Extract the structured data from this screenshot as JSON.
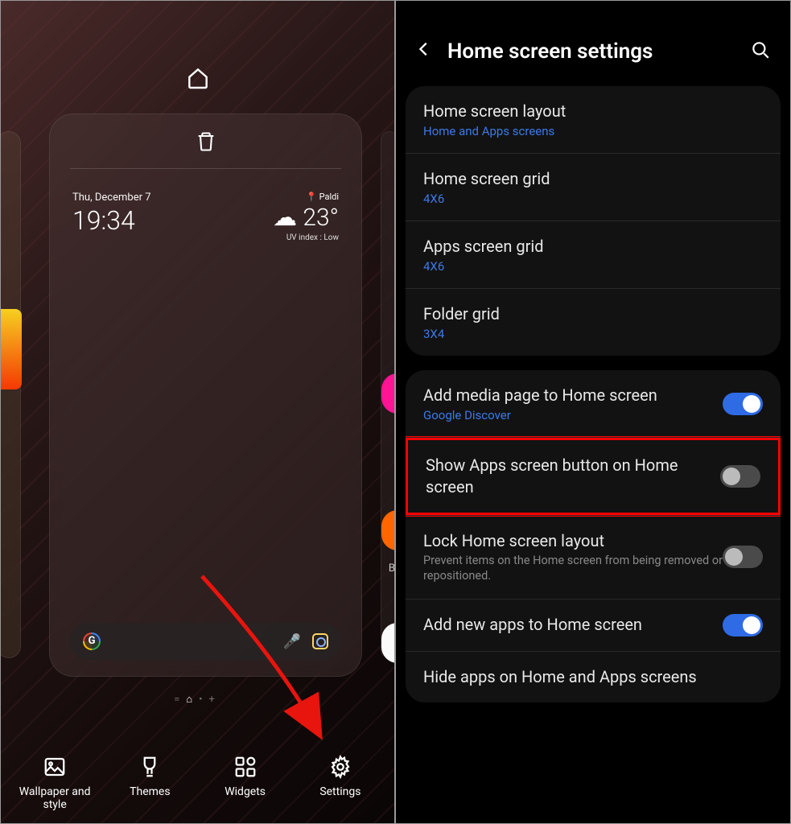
{
  "left": {
    "weather": {
      "date": "Thu, December 7",
      "time": "19:34",
      "location": "Paldi",
      "temperature": "23°",
      "uv": "UV index : Low"
    },
    "peek_letter": "B",
    "page_indicator": {
      "items": [
        "=",
        "⌂",
        "•",
        "+"
      ],
      "active_index": 1
    },
    "toolbar": [
      {
        "label": "Wallpaper and style"
      },
      {
        "label": "Themes"
      },
      {
        "label": "Widgets"
      },
      {
        "label": "Settings"
      }
    ]
  },
  "right": {
    "title": "Home screen settings",
    "section1": [
      {
        "label": "Home screen layout",
        "value": "Home and Apps screens"
      },
      {
        "label": "Home screen grid",
        "value": "4X6"
      },
      {
        "label": "Apps screen grid",
        "value": "4X6"
      },
      {
        "label": "Folder grid",
        "value": "3X4"
      }
    ],
    "section2": [
      {
        "label": "Add media page to Home screen",
        "value": "Google Discover",
        "toggle": true
      },
      {
        "label": "Show Apps screen button on Home screen",
        "toggle": false,
        "highlighted": true
      },
      {
        "label": "Lock Home screen layout",
        "desc": "Prevent items on the Home screen from being removed or repositioned.",
        "toggle": false
      },
      {
        "label": "Add new apps to Home screen",
        "toggle": true
      },
      {
        "label": "Hide apps on Home and Apps screens"
      }
    ]
  }
}
